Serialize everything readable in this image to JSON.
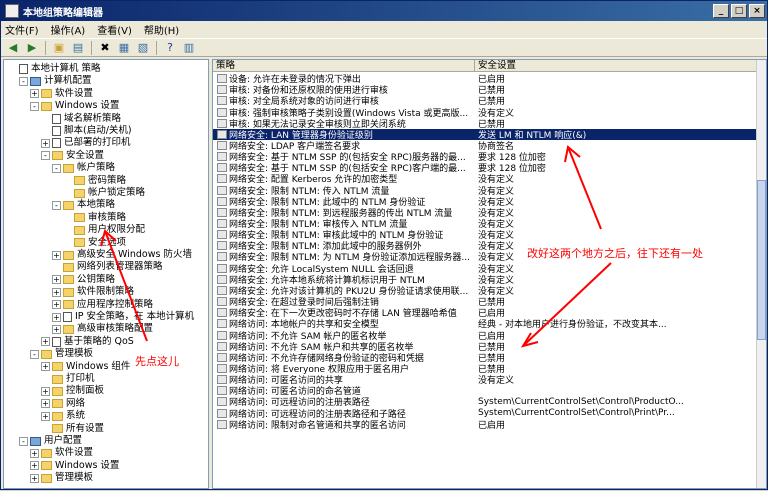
{
  "window": {
    "title": "本地组策略编辑器"
  },
  "menu": [
    "文件(F)",
    "操作(A)",
    "查看(V)",
    "帮助(H)"
  ],
  "tree": [
    {
      "label": "本地计算机 策略",
      "depth": 0,
      "icon": "doc",
      "exp": ""
    },
    {
      "label": "计算机配置",
      "depth": 1,
      "icon": "pc",
      "exp": "-"
    },
    {
      "label": "软件设置",
      "depth": 2,
      "icon": "fold",
      "exp": "+"
    },
    {
      "label": "Windows 设置",
      "depth": 2,
      "icon": "fold",
      "exp": "-"
    },
    {
      "label": "域名解析策略",
      "depth": 3,
      "icon": "doc",
      "exp": ""
    },
    {
      "label": "脚本(启动/关机)",
      "depth": 3,
      "icon": "doc",
      "exp": ""
    },
    {
      "label": "已部署的打印机",
      "depth": 3,
      "icon": "doc",
      "exp": "+"
    },
    {
      "label": "安全设置",
      "depth": 3,
      "icon": "fold",
      "exp": "-"
    },
    {
      "label": "帐户策略",
      "depth": 4,
      "icon": "fold",
      "exp": "-"
    },
    {
      "label": "密码策略",
      "depth": 5,
      "icon": "fold",
      "exp": ""
    },
    {
      "label": "帐户锁定策略",
      "depth": 5,
      "icon": "fold",
      "exp": ""
    },
    {
      "label": "本地策略",
      "depth": 4,
      "icon": "fold",
      "exp": "-"
    },
    {
      "label": "审核策略",
      "depth": 5,
      "icon": "fold",
      "exp": ""
    },
    {
      "label": "用户权限分配",
      "depth": 5,
      "icon": "fold",
      "exp": ""
    },
    {
      "label": "安全选项",
      "depth": 5,
      "icon": "fold",
      "exp": ""
    },
    {
      "label": "高级安全 Windows 防火墙",
      "depth": 4,
      "icon": "fold",
      "exp": "+"
    },
    {
      "label": "网络列表管理器策略",
      "depth": 4,
      "icon": "fold",
      "exp": ""
    },
    {
      "label": "公钥策略",
      "depth": 4,
      "icon": "fold",
      "exp": "+"
    },
    {
      "label": "软件限制策略",
      "depth": 4,
      "icon": "fold",
      "exp": "+"
    },
    {
      "label": "应用程序控制策略",
      "depth": 4,
      "icon": "fold",
      "exp": "+"
    },
    {
      "label": "IP 安全策略，在 本地计算机",
      "depth": 4,
      "icon": "doc",
      "exp": "+"
    },
    {
      "label": "高级审核策略配置",
      "depth": 4,
      "icon": "fold",
      "exp": "+"
    },
    {
      "label": "基于策略的 QoS",
      "depth": 3,
      "icon": "doc",
      "exp": "+"
    },
    {
      "label": "管理模板",
      "depth": 2,
      "icon": "fold",
      "exp": "-"
    },
    {
      "label": "Windows 组件",
      "depth": 3,
      "icon": "fold",
      "exp": "+"
    },
    {
      "label": "打印机",
      "depth": 3,
      "icon": "fold",
      "exp": ""
    },
    {
      "label": "控制面板",
      "depth": 3,
      "icon": "fold",
      "exp": "+"
    },
    {
      "label": "网络",
      "depth": 3,
      "icon": "fold",
      "exp": "+"
    },
    {
      "label": "系统",
      "depth": 3,
      "icon": "fold",
      "exp": "+"
    },
    {
      "label": "所有设置",
      "depth": 3,
      "icon": "fold",
      "exp": ""
    },
    {
      "label": "用户配置",
      "depth": 1,
      "icon": "pc",
      "exp": "-"
    },
    {
      "label": "软件设置",
      "depth": 2,
      "icon": "fold",
      "exp": "+"
    },
    {
      "label": "Windows 设置",
      "depth": 2,
      "icon": "fold",
      "exp": "+"
    },
    {
      "label": "管理模板",
      "depth": 2,
      "icon": "fold",
      "exp": "+"
    }
  ],
  "list": {
    "headers": [
      "策略",
      "安全设置"
    ],
    "rows": [
      [
        "设备: 允许在未登录的情况下弹出",
        "已启用"
      ],
      [
        "审核: 对备份和还原权限的使用进行审核",
        "已禁用"
      ],
      [
        "审核: 对全局系统对象的访问进行审核",
        "已禁用"
      ],
      [
        "审核: 强制审核策略子类别设置(Windows Vista 或更高版...",
        "没有定义"
      ],
      [
        "审核: 如果无法记录安全审核则立即关闭系统",
        "已禁用"
      ],
      [
        "网络安全: LAN 管理器身份验证级别",
        "发送 LM 和 NTLM 响应(&)"
      ],
      [
        "网络安全: LDAP 客户端签名要求",
        "协商签名"
      ],
      [
        "网络安全: 基于 NTLM SSP 的(包括安全 RPC)服务器的最...",
        "要求 128 位加密"
      ],
      [
        "网络安全: 基于 NTLM SSP 的(包括安全 RPC)客户端的最...",
        "要求 128 位加密"
      ],
      [
        "网络安全: 配置 Kerberos 允许的加密类型",
        "没有定义"
      ],
      [
        "网络安全: 限制 NTLM: 传入 NTLM 流量",
        "没有定义"
      ],
      [
        "网络安全: 限制 NTLM: 此域中的 NTLM 身份验证",
        "没有定义"
      ],
      [
        "网络安全: 限制 NTLM: 到远程服务器的传出 NTLM 流量",
        "没有定义"
      ],
      [
        "网络安全: 限制 NTLM: 审核传入 NTLM 流量",
        "没有定义"
      ],
      [
        "网络安全: 限制 NTLM: 审核此域中的 NTLM 身份验证",
        "没有定义"
      ],
      [
        "网络安全: 限制 NTLM: 添加此域中的服务器例外",
        "没有定义"
      ],
      [
        "网络安全: 限制 NTLM: 为 NTLM 身份验证添加远程服务器...",
        "没有定义"
      ],
      [
        "网络安全: 允许 LocalSystem NULL 会话回退",
        "没有定义"
      ],
      [
        "网络安全: 允许本地系统将计算机标识用于 NTLM",
        "没有定义"
      ],
      [
        "网络安全: 允许对该计算机的 PKU2U 身份验证请求使用联...",
        "没有定义"
      ],
      [
        "网络安全: 在超过登录时间后强制注销",
        "已禁用"
      ],
      [
        "网络安全: 在下一次更改密码时不存储 LAN 管理器哈希值",
        "已启用"
      ],
      [
        "网络访问: 本地帐户的共享和安全模型",
        "经典 - 对本地用户进行身份验证，不改变其本..."
      ],
      [
        "网络访问: 不允许 SAM 帐户的匿名枚举",
        "已启用"
      ],
      [
        "网络访问: 不允许 SAM 帐户和共享的匿名枚举",
        "已禁用"
      ],
      [
        "网络访问: 不允许存储网络身份验证的密码和凭据",
        "已禁用"
      ],
      [
        "网络访问: 将 Everyone 权限应用于匿名用户",
        "已禁用"
      ],
      [
        "网络访问: 可匿名访问的共享",
        "没有定义"
      ],
      [
        "网络访问: 可匿名访问的命名管道",
        ""
      ],
      [
        "网络访问: 可远程访问的注册表路径",
        "System\\CurrentControlSet\\Control\\ProductO..."
      ],
      [
        "网络访问: 可远程访问的注册表路径和子路径",
        "System\\CurrentControlSet\\Control\\Print\\Pr..."
      ],
      [
        "网络访问: 限制对命名管道和共享的匿名访问",
        "已启用"
      ]
    ],
    "selected_index": 5
  },
  "annotations": {
    "left_note": "先点这儿",
    "right_note": "改好这两个地方之后，往下还有一处"
  },
  "colors": {
    "annotation": "#ff0000",
    "selection": "#0a246a"
  }
}
